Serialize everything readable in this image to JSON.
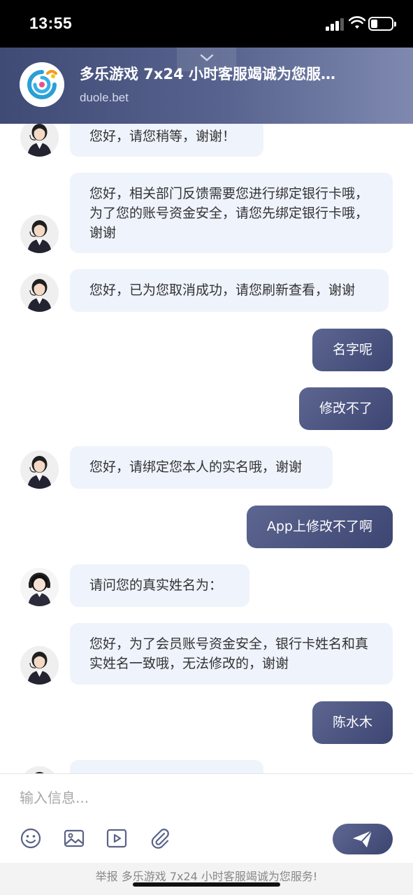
{
  "status_bar": {
    "time": "13:55"
  },
  "header": {
    "title": "多乐游戏 7x24 小时客服竭诚为您服…",
    "domain": "duole.bet"
  },
  "messages": [
    {
      "side": "in",
      "text": "您好，请您稍等，谢谢！"
    },
    {
      "side": "in",
      "text": "您好，相关部门反馈需要您进行绑定银行卡哦，为了您的账号资金安全，请您先绑定银行卡哦，谢谢"
    },
    {
      "side": "in",
      "text": "您好，已为您取消成功，请您刷新查看，谢谢"
    },
    {
      "side": "out",
      "text": "名字呢"
    },
    {
      "side": "out",
      "text": "修改不了"
    },
    {
      "side": "in",
      "text": "您好，请绑定您本人的实名哦，谢谢"
    },
    {
      "side": "out",
      "text": "App上修改不了啊"
    },
    {
      "side": "in",
      "text": "请问您的真实姓名为："
    },
    {
      "side": "in",
      "text": "您好，为了会员账号资金安全，银行卡姓名和真实姓名一致哦，无法修改的，谢谢"
    },
    {
      "side": "out",
      "text": "陈水木"
    }
  ],
  "input": {
    "placeholder": "输入信息..."
  },
  "toolbar": {
    "icons": [
      "emoji-icon",
      "image-icon",
      "video-icon",
      "attachment-icon"
    ],
    "send_icon": "send-icon"
  },
  "report": {
    "text": "举报 多乐游戏 7x24 小时客服竭诚为您服务!"
  },
  "colors": {
    "header_start": "#3f4a75",
    "header_end": "#7f89b0",
    "bubble_in": "#eef3fc",
    "bubble_out": "#4a5480"
  }
}
